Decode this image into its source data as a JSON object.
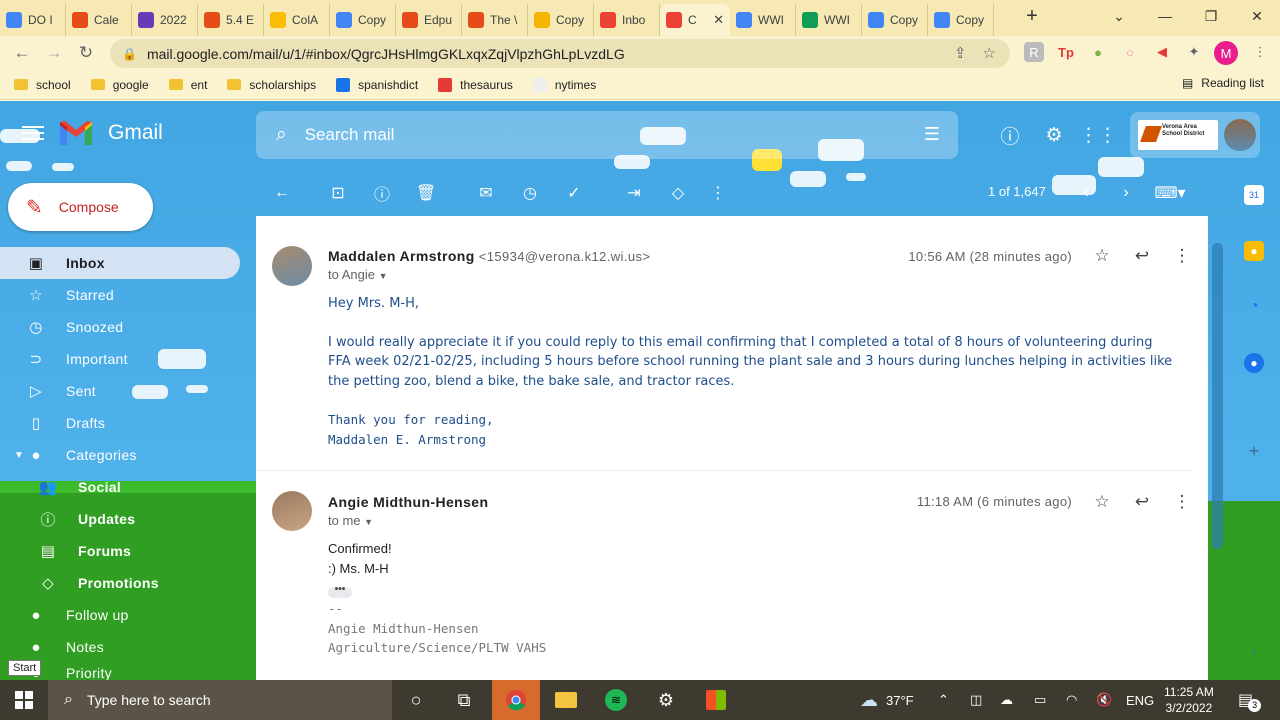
{
  "browser": {
    "tabs": [
      {
        "label": "DO I",
        "icon": "google-docs-icon",
        "color": "#4285f4"
      },
      {
        "label": "Cale",
        "icon": "canvas-icon",
        "color": "#e64a19"
      },
      {
        "label": "2022",
        "icon": "forms-icon",
        "color": "#673ab7"
      },
      {
        "label": "5.4 E",
        "icon": "canvas-icon",
        "color": "#e64a19"
      },
      {
        "label": "ColA",
        "icon": "check-icon",
        "color": "#fbbc04"
      },
      {
        "label": "Copy",
        "icon": "google-docs-icon",
        "color": "#4285f4"
      },
      {
        "label": "Edpu",
        "icon": "canvas-icon",
        "color": "#e64a19"
      },
      {
        "label": "The \\",
        "icon": "canvas-icon",
        "color": "#e64a19"
      },
      {
        "label": "Copy",
        "icon": "slides-icon",
        "color": "#f4b400"
      },
      {
        "label": "Inbo",
        "icon": "gmail-icon",
        "color": "#ea4335"
      },
      {
        "label": "C",
        "icon": "gmail-icon",
        "color": "#ea4335",
        "active": true
      },
      {
        "label": "WWI",
        "icon": "google-docs-icon",
        "color": "#4285f4"
      },
      {
        "label": "WWI",
        "icon": "drive-icon",
        "color": "#0f9d58"
      },
      {
        "label": "Copy",
        "icon": "google-docs-icon",
        "color": "#4285f4"
      },
      {
        "label": "Copy",
        "icon": "google-docs-icon",
        "color": "#4285f4"
      }
    ],
    "url": "mail.google.com/mail/u/1/#inbox/QgrcJHsHlmgGKLxqxZqjVlpzhGhLpLvzdLG",
    "profile_initial": "M",
    "bookmarks": [
      {
        "label": "school",
        "type": "folder"
      },
      {
        "label": "google",
        "type": "folder"
      },
      {
        "label": "ent",
        "type": "folder"
      },
      {
        "label": "scholarships",
        "type": "folder"
      },
      {
        "label": "spanishdict",
        "type": "site",
        "color": "#1a73e8"
      },
      {
        "label": "thesaurus",
        "type": "site",
        "color": "#e53935"
      },
      {
        "label": "nytimes",
        "type": "site",
        "color": "#eeeeee"
      }
    ],
    "reading_list": "Reading list"
  },
  "gmail": {
    "brand": "Gmail",
    "search_placeholder": "Search mail",
    "compose_label": "Compose",
    "org_name": "Verona Area School District",
    "nav": [
      {
        "label": "Inbox",
        "icon": "inbox-icon",
        "active": true
      },
      {
        "label": "Starred",
        "icon": "star-icon"
      },
      {
        "label": "Snoozed",
        "icon": "clock-icon"
      },
      {
        "label": "Important",
        "icon": "important-icon"
      },
      {
        "label": "Sent",
        "icon": "send-icon"
      },
      {
        "label": "Drafts",
        "icon": "draft-icon"
      },
      {
        "label": "Categories",
        "icon": "label-icon"
      },
      {
        "label": "Social",
        "icon": "people-icon",
        "sub": true
      },
      {
        "label": "Updates",
        "icon": "info-icon",
        "sub": true
      },
      {
        "label": "Forums",
        "icon": "forum-icon",
        "sub": true
      },
      {
        "label": "Promotions",
        "icon": "tag-icon",
        "sub": true
      },
      {
        "label": "Follow up",
        "icon": "label-icon"
      },
      {
        "label": "Notes",
        "icon": "label-icon"
      },
      {
        "label": "Priority",
        "icon": "label-icon"
      }
    ],
    "pager": "1 of 1,647",
    "messages": [
      {
        "sender": "Maddalen Armstrong",
        "email": "<15934@verona.k12.wi.us>",
        "to": "to Angie",
        "time": "10:56 AM (28 minutes ago)",
        "greeting": "Hey Mrs. M-H,",
        "body": "I would really appreciate it if you could reply to this email confirming that I completed a total of 8 hours of volunteering during FFA week 02/21-02/25, including 5 hours before school running the plant sale and 3 hours during lunches helping in activities like the petting zoo, blend a bike, the bake sale, and tractor races.",
        "closing1": "Thank you for reading,",
        "closing2": "Maddalen E. Armstrong"
      },
      {
        "sender": "Angie Midthun-Hensen",
        "to": "to me",
        "time": "11:18 AM (6 minutes ago)",
        "line1": "Confirmed!",
        "line2": ":) Ms. M-H",
        "sig_dash": "--",
        "sig_name": "Angie Midthun-Hensen",
        "sig_title": "Agriculture/Science/PLTW VAHS"
      }
    ],
    "start_tooltip": "Start"
  },
  "taskbar": {
    "search_placeholder": "Type here to search",
    "weather": "37°F",
    "lang": "ENG",
    "time": "11:25 AM",
    "date": "3/2/2022",
    "notif_count": "3"
  }
}
